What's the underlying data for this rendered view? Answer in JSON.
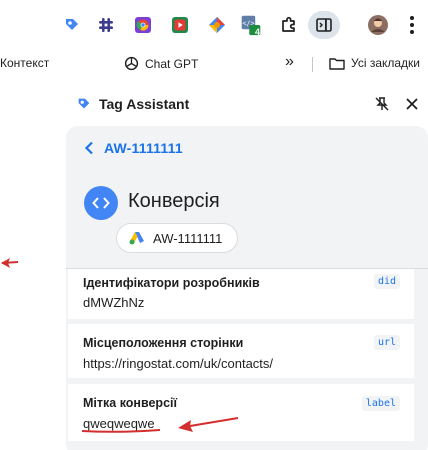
{
  "toolbar": {
    "extensions": [
      "tag-assistant-icon",
      "slack-icon",
      "chrome-extension-icon",
      "youtube-extension-icon",
      "colorful-extension-icon",
      "code-extension-icon",
      "puzzle-icon",
      "side-panel-icon",
      "profile-avatar",
      "more-icon"
    ],
    "badge_count": "4"
  },
  "bookmarks": {
    "item1": "Контекст",
    "item2": "Chat GPT",
    "overflow": "»",
    "all_bookmarks": "Усі закладки"
  },
  "panel": {
    "title": "Tag Assistant",
    "back_label": "AW-1111111",
    "conversion_title": "Конверсія",
    "chip_label": "AW-1111111"
  },
  "rows": [
    {
      "label": "Ідентифікатори розробників",
      "value": "dMWZhNz",
      "tag": "did"
    },
    {
      "label": "Місцеположення сторінки",
      "value": "https://ringostat.com/uk/contacts/",
      "tag": "url"
    },
    {
      "label": "Мітка конверсії",
      "value": "qweqweqwe",
      "tag": "label"
    }
  ],
  "colors": {
    "accent_blue": "#1a73e8",
    "annotation_red": "#d32f2f",
    "card_bg": "#f1f3f4"
  }
}
